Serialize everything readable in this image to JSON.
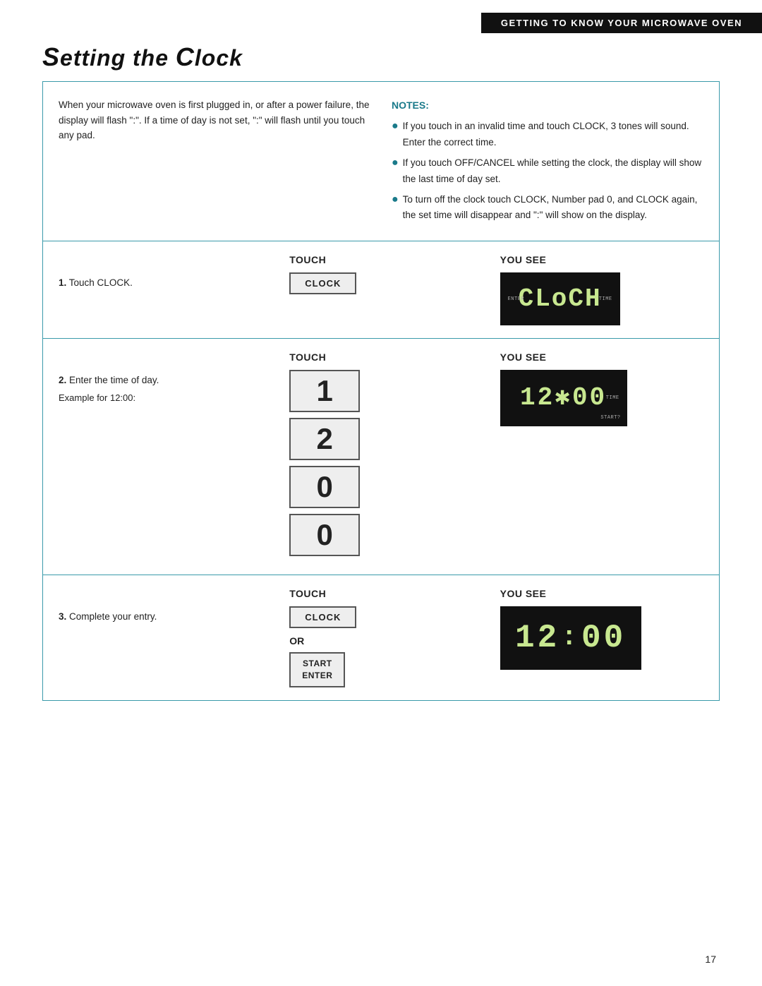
{
  "header": {
    "banner": "Getting to Know Your Microwave Oven"
  },
  "title": "Setting the Clock",
  "intro": {
    "left_text": "When your microwave oven is first plugged in, or after a power failure, the display will flash \":\". If a time of day is not set, \":\" will flash until you touch any pad.",
    "notes_label": "NOTES:",
    "notes": [
      "If you touch in an invalid time and touch CLOCK, 3 tones will sound. Enter the correct time.",
      "If you touch OFF/CANCEL while setting the clock, the display will show the last time of day set.",
      "To turn off the clock touch CLOCK, Number pad 0, and CLOCK again, the set time will disappear and \":\" will show on the display."
    ]
  },
  "steps": [
    {
      "step_num": "1.",
      "step_desc": "Touch CLOCK.",
      "touch_header": "TOUCH",
      "you_see_header": "YOU SEE",
      "touch_items": [
        {
          "type": "btn_clock",
          "label": "CLOCK"
        }
      ],
      "display_text": "CLoCH",
      "display_top_left": "ENTER",
      "display_top_right": "TIME"
    },
    {
      "step_num": "2.",
      "step_desc": "Enter the time of day.",
      "step_sub": "Example for 12:00:",
      "touch_header": "TOUCH",
      "you_see_header": "YOU SEE",
      "touch_items": [
        {
          "type": "btn_number",
          "label": "1"
        },
        {
          "type": "btn_number",
          "label": "2"
        },
        {
          "type": "btn_number",
          "label": "0"
        },
        {
          "type": "btn_number",
          "label": "0"
        }
      ],
      "display_text": "12*00",
      "display_top_right": "TIME",
      "display_bottom_right": "START?"
    },
    {
      "step_num": "3.",
      "step_desc": "Complete your entry.",
      "touch_header": "TOUCH",
      "you_see_header": "YOU SEE",
      "touch_items": [
        {
          "type": "btn_clock",
          "label": "CLOCK"
        },
        {
          "type": "or_label",
          "label": "OR"
        },
        {
          "type": "btn_start",
          "label": "START\nENTER"
        }
      ],
      "display_text": "12: 00"
    }
  ],
  "page_number": "17"
}
